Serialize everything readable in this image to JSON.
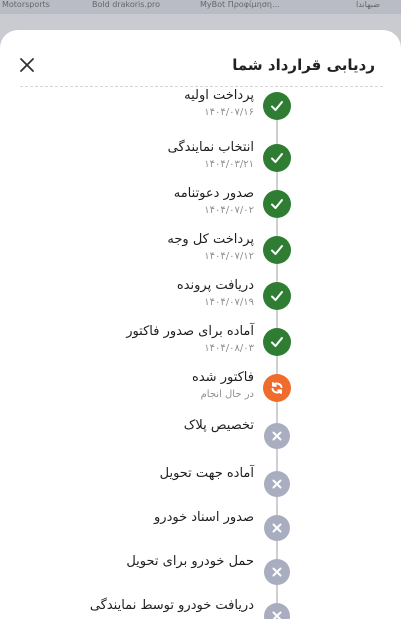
{
  "top_bar": {
    "items": [
      "Motorsports",
      "Bold drakoris.pro",
      "MyBot Προφίμηση...",
      "ضبهاندا"
    ]
  },
  "panel": {
    "title": "ردیابی قرارداد شما",
    "close_icon": "close-icon"
  },
  "colors": {
    "done": "#2e7d32",
    "in_progress": "#ef6c2d",
    "pending": "#a9adc0"
  },
  "steps": [
    {
      "label": "پرداخت اولیه",
      "date": "۱۴۰۴/۰۷/۱۶",
      "status": "done",
      "icon": "check-icon"
    },
    {
      "label": "انتخاب نمایندگی",
      "date": "۱۴۰۴/۰۳/۲۱",
      "status": "done",
      "icon": "check-icon"
    },
    {
      "label": "صدور دعوتنامه",
      "date": "۱۴۰۴/۰۷/۰۲",
      "status": "done",
      "icon": "check-icon"
    },
    {
      "label": "پرداخت کل وجه",
      "date": "۱۴۰۴/۰۷/۱۲",
      "status": "done",
      "icon": "check-icon"
    },
    {
      "label": "دریافت پرونده",
      "date": "۱۴۰۴/۰۷/۱۹",
      "status": "done",
      "icon": "check-icon"
    },
    {
      "label": "آماده برای صدور فاکتور",
      "date": "۱۴۰۴/۰۸/۰۳",
      "status": "done",
      "icon": "check-icon"
    },
    {
      "label": "فاکتور شده",
      "date": "در حال انجام",
      "status": "in_progress",
      "icon": "sync-icon"
    },
    {
      "label": "تخصیص پلاک",
      "date": "",
      "status": "pending",
      "icon": "x-icon"
    },
    {
      "label": "آماده جهت تحویل",
      "date": "",
      "status": "pending",
      "icon": "x-icon"
    },
    {
      "label": "صدور اسناد خودرو",
      "date": "",
      "status": "pending",
      "icon": "x-icon"
    },
    {
      "label": "حمل خودرو برای تحویل",
      "date": "",
      "status": "pending",
      "icon": "x-icon"
    },
    {
      "label": "دریافت خودرو توسط نمایندگی",
      "date": "",
      "status": "pending",
      "icon": "x-icon"
    }
  ]
}
